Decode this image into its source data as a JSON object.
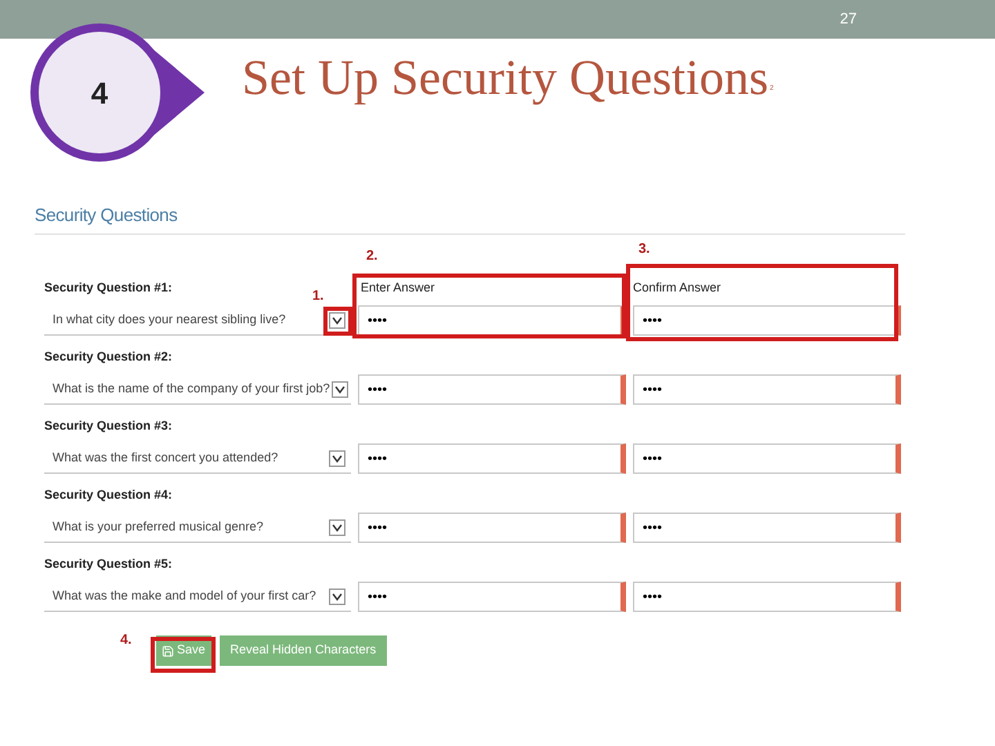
{
  "slide_number": "27",
  "step_badge": "4",
  "title": "Set Up Security Questions",
  "title_mark": "2",
  "form": {
    "heading": "Security Questions",
    "answer_header": "Enter Answer",
    "confirm_header": "Confirm Answer",
    "questions": [
      {
        "label": "Security Question #1:",
        "question": "In what city does your nearest sibling live?",
        "answer": "••••",
        "confirm": "••••"
      },
      {
        "label": "Security Question #2:",
        "question": "What is the name of the company of your first job?",
        "answer": "••••",
        "confirm": "••••"
      },
      {
        "label": "Security Question #3:",
        "question": "What was the first concert you attended?",
        "answer": "••••",
        "confirm": "••••"
      },
      {
        "label": "Security Question #4:",
        "question": "What is your preferred musical genre?",
        "answer": "••••",
        "confirm": "••••"
      },
      {
        "label": "Security Question #5:",
        "question": "What was the make and model of your first car?",
        "answer": "••••",
        "confirm": "••••"
      }
    ]
  },
  "buttons": [
    {
      "label": "Save",
      "kind": "save"
    },
    {
      "label": "Reveal Hidden Characters",
      "kind": "plain"
    }
  ],
  "annotations": [
    "1.",
    "2.",
    "3.",
    "4."
  ]
}
